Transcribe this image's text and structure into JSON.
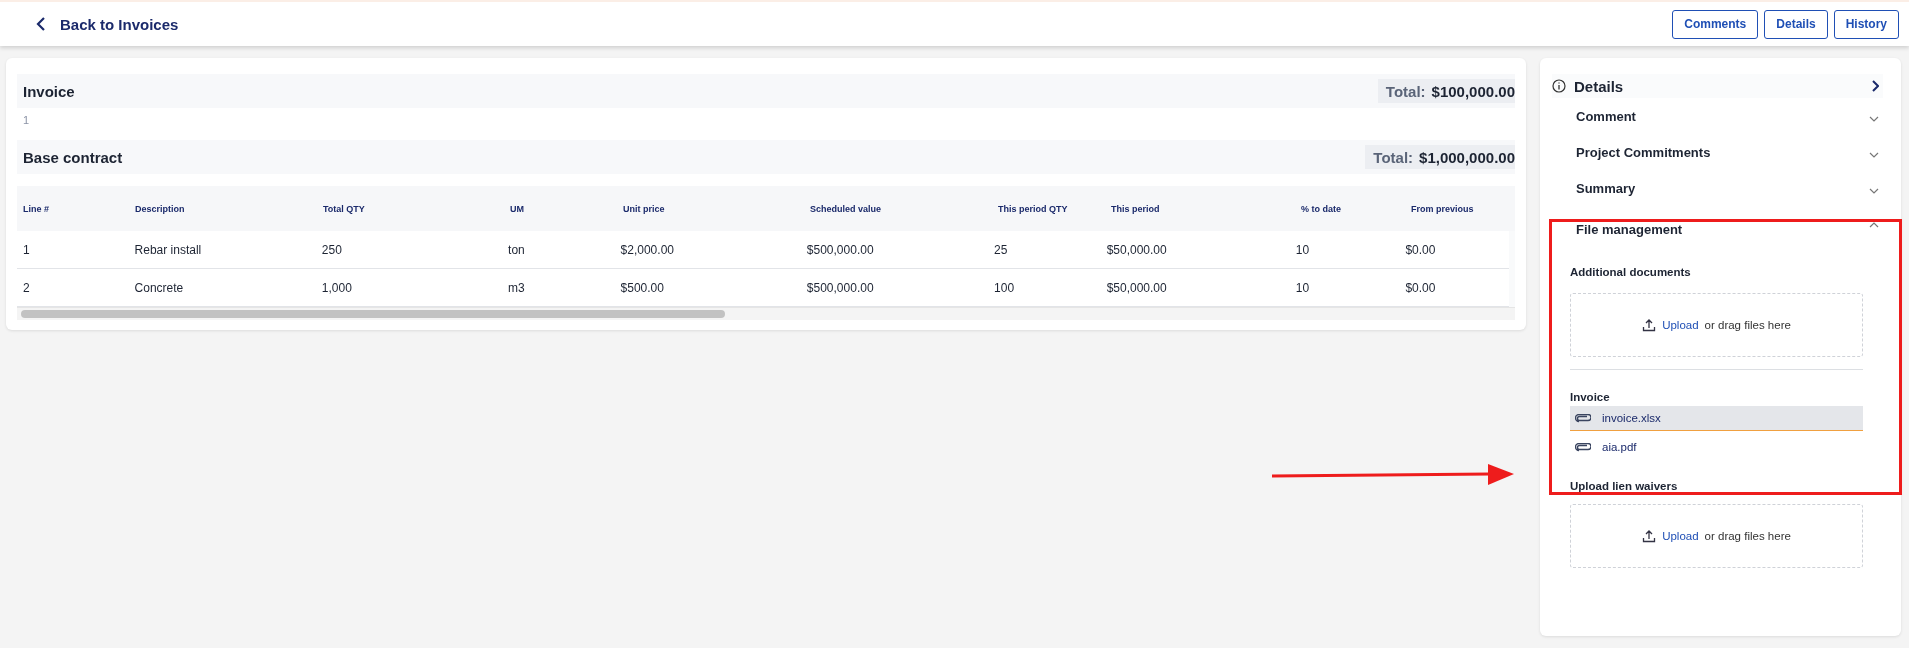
{
  "header": {
    "back_link": "Back to Invoices",
    "buttons": [
      "Comments",
      "Details",
      "History"
    ]
  },
  "invoice": {
    "title": "Invoice",
    "total_label": "Total:",
    "total": "$100,000.00",
    "number": "1"
  },
  "base_contract": {
    "title": "Base contract",
    "total_label": "Total:",
    "total": "$1,000,000.00"
  },
  "table": {
    "columns": [
      "Line #",
      "Description",
      "Total QTY",
      "UM",
      "Unit price",
      "Scheduled value",
      "This period QTY",
      "This period",
      "% to date",
      "From previous"
    ],
    "rows": [
      [
        "1",
        "Rebar install",
        "250",
        "ton",
        "$2,000.00",
        "$500,000.00",
        "25",
        "$50,000.00",
        "10",
        "$0.00"
      ],
      [
        "2",
        "Concrete",
        "1,000",
        "m3",
        "$500.00",
        "$500,000.00",
        "100",
        "$50,000.00",
        "10",
        "$0.00"
      ]
    ]
  },
  "panel": {
    "title": "Details",
    "sections": [
      {
        "title": "Comment",
        "expanded": false
      },
      {
        "title": "Project Commitments",
        "expanded": false
      },
      {
        "title": "Summary",
        "expanded": false
      },
      {
        "title": "File management",
        "expanded": true
      }
    ],
    "additional_documents": {
      "label": "Additional documents",
      "upload_link": "Upload",
      "upload_text": "or drag files here"
    },
    "invoice_files": {
      "label": "Invoice",
      "files": [
        {
          "name": "invoice.xlsx",
          "selected": true
        },
        {
          "name": "aia.pdf",
          "selected": false
        }
      ]
    },
    "lien_waivers": {
      "label": "Upload lien waivers",
      "upload_link": "Upload",
      "upload_text": "or drag files here"
    }
  }
}
